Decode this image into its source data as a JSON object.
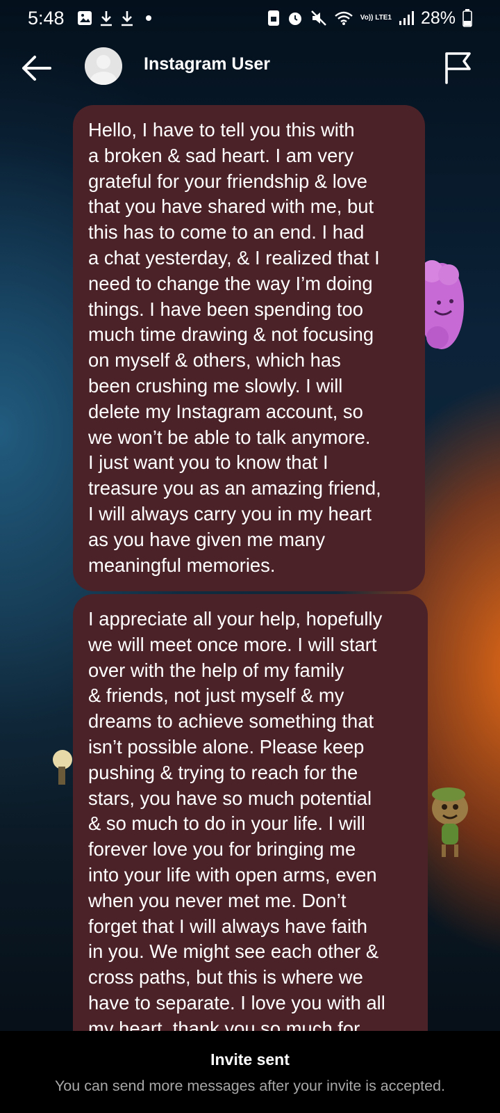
{
  "status_bar": {
    "time": "5:48",
    "battery": "28%",
    "icons_left": [
      "gallery-icon",
      "download-icon",
      "download-icon",
      "dot-icon"
    ],
    "icons_right": [
      "screen-lock-icon",
      "alarm-icon",
      "mute-icon",
      "wifi-icon",
      "volte-icon",
      "signal-icon",
      "battery-icon"
    ],
    "volte_label": "Vo)) LTE1"
  },
  "header": {
    "username": "Instagram User",
    "back_icon": "arrow-left-icon",
    "flag_icon": "flag-icon"
  },
  "messages": [
    {
      "text": "Hello, I have to tell you this with\na broken & sad heart. I am very\ngrateful for your friendship & love\nthat you have shared with me, but\nthis has to come to an end. I had\na chat yesterday, & I realized that I\nneed to change the way I’m doing\nthings. I have been spending too\nmuch time drawing & not focusing\non myself & others, which has\nbeen crushing me slowly. I will\ndelete my Instagram account, so\nwe won’t be able to talk anymore.\nI just want you to know that I\ntreasure you as an amazing friend,\nI will always carry you in my heart\nas you have given me many\nmeaningful memories."
    },
    {
      "text": "I appreciate all your help, hopefully\nwe will meet once more. I will start\nover with the help of my family\n& friends, not just myself & my\ndreams to achieve something that\nisn’t possible alone. Please keep\npushing & trying to reach for the\nstars, you have so much potential\n& so much to do in your life. I will\nforever love you for bringing me\ninto your life with open arms, even\nwhen you never met me. Don’t\nforget that I will always have faith\nin you. We might see each other &\ncross paths, but this is where we\nhave to separate. I love you with all\nmy heart, thank you so much for"
    }
  ],
  "footer": {
    "title": "Invite sent",
    "subtitle": "You can send more messages after your invite is accepted."
  },
  "colors": {
    "bubble": "#4b2228",
    "footer_bg": "#000000",
    "subtitle": "#a8a8a8"
  }
}
